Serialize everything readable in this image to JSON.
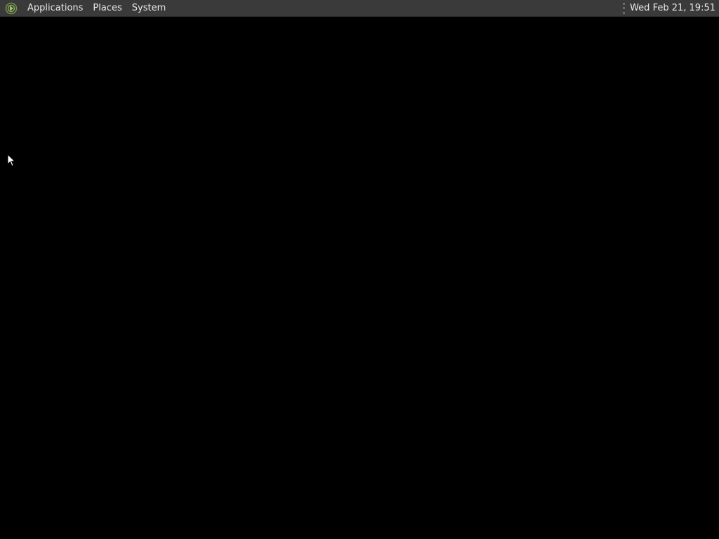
{
  "panel": {
    "logo_icon": "mate-logo-icon",
    "menus": {
      "applications": "Applications",
      "places": "Places",
      "system": "System"
    },
    "clock": "Wed Feb 21, 19:51"
  },
  "desktop": {
    "background_color": "#000000",
    "cursor_icon": "mouse-pointer-icon"
  },
  "colors": {
    "panel_bg": "#3a3a3a",
    "panel_text": "#e8e8e8",
    "logo_green": "#8bb158"
  }
}
